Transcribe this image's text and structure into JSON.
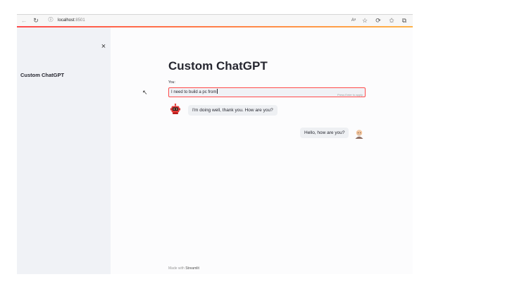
{
  "browser": {
    "url_host": "localhost",
    "url_port": ":8501",
    "icons": [
      "back-icon",
      "reload-icon",
      "info-icon",
      "read-aloud-icon",
      "favorite-add-icon",
      "refresh-icon",
      "favorites-icon",
      "collections-icon"
    ],
    "read_aloud_label": "Aᵃ"
  },
  "sidebar": {
    "title": "Custom ChatGPT",
    "close_label": "×"
  },
  "main": {
    "title": "Custom ChatGPT",
    "input_label": "You:",
    "input_value": "I need to build a pc from",
    "input_hint": "Press Enter to apply"
  },
  "messages": [
    {
      "role": "bot",
      "text": "I'm doing well, thank you. How are you?"
    },
    {
      "role": "user",
      "text": "Hello, how are you?"
    }
  ],
  "footer": {
    "prefix": "Made with ",
    "brand": "Streamlit"
  },
  "colors": {
    "accent": "#ff4b4b",
    "sidebar_bg": "#f0f2f6",
    "bubble_bg": "#eef0f3"
  }
}
